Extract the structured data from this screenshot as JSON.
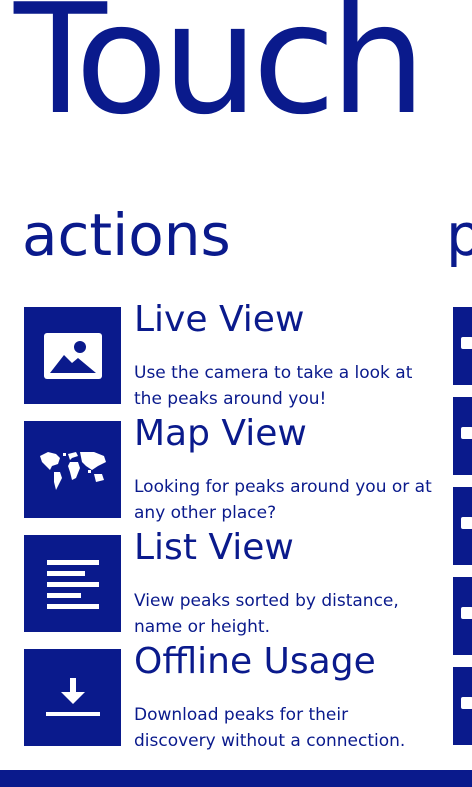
{
  "hub": {
    "title": "Touch",
    "next_section_header": "p"
  },
  "actions": {
    "header": "actions",
    "items": [
      {
        "title": "Live View",
        "description": "Use the camera to take a look at the peaks around you!",
        "icon": "picture-icon"
      },
      {
        "title": "Map View",
        "description": "Looking for peaks around you or at any other place?",
        "icon": "world-map-icon"
      },
      {
        "title": "List View",
        "description": "View peaks sorted by distance, name or height.",
        "icon": "list-icon"
      },
      {
        "title": "Offline Usage",
        "description": "Download peaks for their discovery without a connection.",
        "icon": "download-icon"
      }
    ]
  },
  "colors": {
    "accent": "#0a1a8c",
    "background": "#ffffff"
  }
}
